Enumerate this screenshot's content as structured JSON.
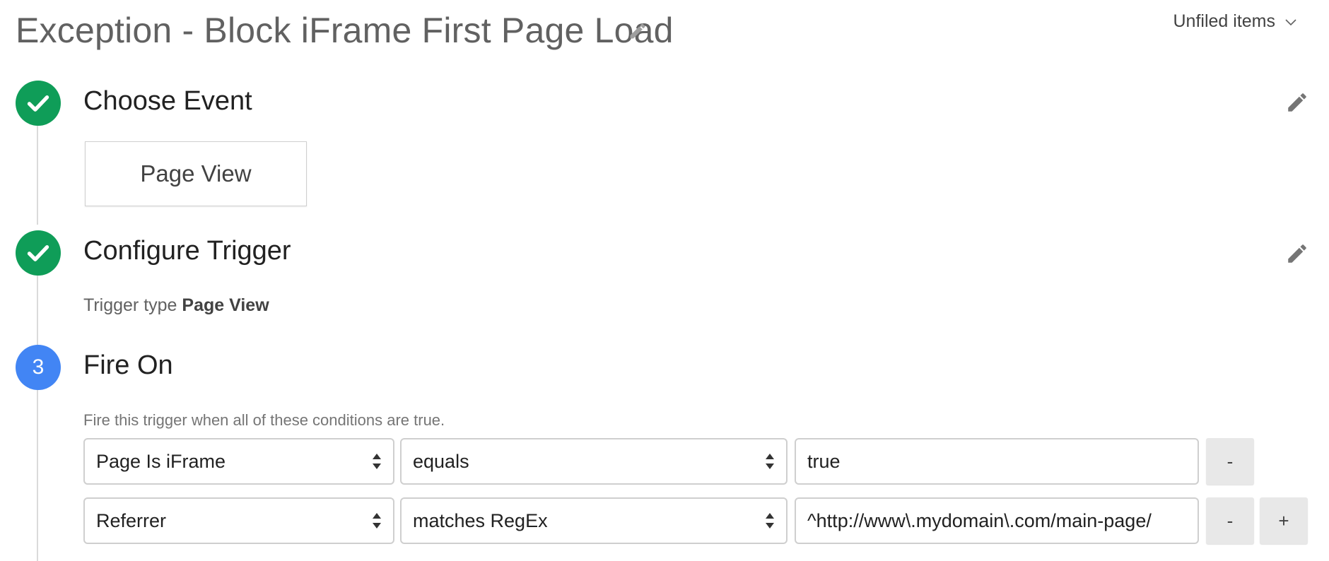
{
  "header": {
    "title": "Exception - Block iFrame First Page Load",
    "folder_label": "Unfiled items"
  },
  "steps": [
    {
      "status": "done",
      "title": "Choose Event",
      "event_tile": "Page View"
    },
    {
      "status": "done",
      "title": "Configure Trigger",
      "trigger_type_prefix": "Trigger type",
      "trigger_type_value": "Page View"
    },
    {
      "status": "current",
      "number": "3",
      "title": "Fire On",
      "intro": "Fire this trigger when all of these conditions are true."
    }
  ],
  "conditions": [
    {
      "variable": "Page Is iFrame",
      "operator": "equals",
      "value": "true",
      "remove_label": "-"
    },
    {
      "variable": "Referrer",
      "operator": "matches RegEx",
      "value": "^http://www\\.mydomain\\.com/main-page/",
      "remove_label": "-",
      "add_label": "+"
    }
  ],
  "icons": {
    "check": "check-icon",
    "pencil": "pencil-icon",
    "chevron": "chevron-down-icon",
    "select_arrows": "select-arrows-icon"
  },
  "colors": {
    "done": "#0f9d58",
    "current": "#4285f4"
  }
}
